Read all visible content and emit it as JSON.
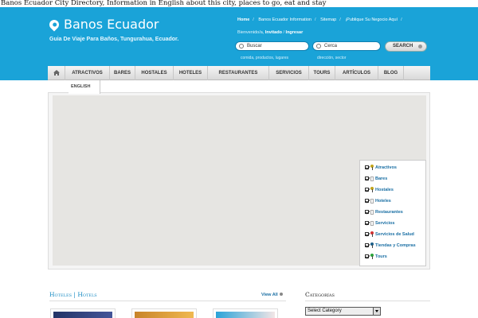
{
  "page_heading": "Banos Ecuador City Directory, Information in English about this city, places to go, eat and stay",
  "site": {
    "logo": "Banos Ecuador",
    "tagline": "Guia De Viaje Para Baños, Tungurahua, Ecuador."
  },
  "top_links": [
    "Home",
    "Banos Ecuador Information",
    "Sitemap",
    "¡Publique Su Negocio Aquí"
  ],
  "welcome": {
    "prefix": "Bienvenido/a, ",
    "user": "Invitado",
    "login": "Ingresar"
  },
  "search": {
    "what_placeholder": "Buscar",
    "what_hint": "comida, productos, lugares",
    "where_placeholder": "Cerca",
    "where_hint": "dirección, sector",
    "button": "SEARCH"
  },
  "nav": [
    "ATRACTIVOS",
    "BARES",
    "HOSTALES",
    "HOTELES",
    "RESTAURANTES",
    "SERVICIOS",
    "TOURS",
    "ARTÍCULOS",
    "BLOG"
  ],
  "subnav": [
    "ENGLISH"
  ],
  "legend": [
    {
      "label": "Atractivos",
      "checked": true,
      "marker": "#c2a41a"
    },
    {
      "label": "Bares",
      "checked": true,
      "marker": ""
    },
    {
      "label": "Hostales",
      "checked": true,
      "marker": "#c2a41a"
    },
    {
      "label": "Hoteles",
      "checked": true,
      "marker": ""
    },
    {
      "label": "Restaurantes",
      "checked": true,
      "marker": ""
    },
    {
      "label": "Servicios",
      "checked": true,
      "marker": ""
    },
    {
      "label": "Servicios de Salud",
      "checked": true,
      "marker": "#d43030"
    },
    {
      "label": "Tiendas y Compras",
      "checked": true,
      "marker": "#1a5f8a"
    },
    {
      "label": "Tours",
      "checked": true,
      "marker": "#2aa33a"
    }
  ],
  "hotels_section": {
    "title": "Hoteles | Hotels",
    "view_all": "View All"
  },
  "categories": {
    "title": "Categorías",
    "select_value": "Select Category"
  },
  "colors": {
    "header": "#1aa3d8",
    "link": "#1a6fa4",
    "map": "#e6e5e2"
  }
}
